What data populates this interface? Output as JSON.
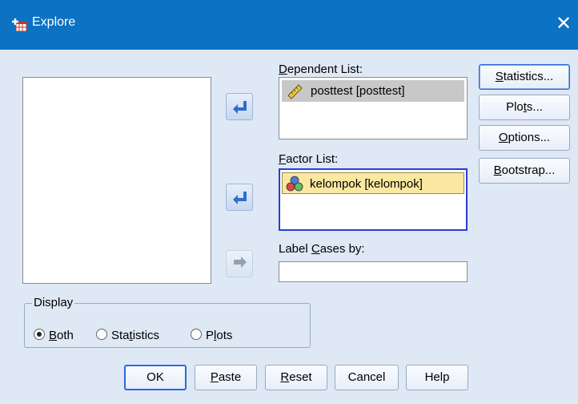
{
  "window": {
    "title": "Explore",
    "close_label": "✕"
  },
  "labels": {
    "dependent_prefix": "",
    "dependent_u": "D",
    "dependent_rest": "ependent List:",
    "factor_prefix": "",
    "factor_u": "F",
    "factor_rest": "actor List:",
    "label_cases_prefix": "Label ",
    "label_cases_u": "C",
    "label_cases_rest": "ases by:"
  },
  "dependent_list": [
    {
      "text": "posttest [posttest]",
      "icon": "ruler-scale-icon"
    }
  ],
  "factor_list": [
    {
      "text": "kelompok [kelompok]",
      "icon": "nominal-circles-icon"
    }
  ],
  "side_buttons": {
    "statistics": {
      "u": "S",
      "rest": "tatistics..."
    },
    "plots": {
      "pre": "Plo",
      "u": "t",
      "rest": "s..."
    },
    "options": {
      "u": "O",
      "rest": "ptions..."
    },
    "bootstrap": {
      "u": "B",
      "rest": "ootstrap..."
    }
  },
  "display": {
    "legend": "Display",
    "both": {
      "u": "B",
      "rest": "oth"
    },
    "statistics": {
      "pre": "Sta",
      "u": "t",
      "rest": "istics"
    },
    "plots": {
      "pre": "P",
      "u": "l",
      "rest": "ots"
    },
    "selected": "Both"
  },
  "bottom_buttons": {
    "ok": "OK",
    "paste": {
      "u": "P",
      "rest": "aste"
    },
    "reset": {
      "u": "R",
      "rest": "eset"
    },
    "cancel": "Cancel",
    "help": "Help"
  },
  "colors": {
    "titlebar": "#0b72c4",
    "panel": "#dfe8f5",
    "focus": "#2a3cd6",
    "factor_highlight": "#fbe8a0"
  }
}
